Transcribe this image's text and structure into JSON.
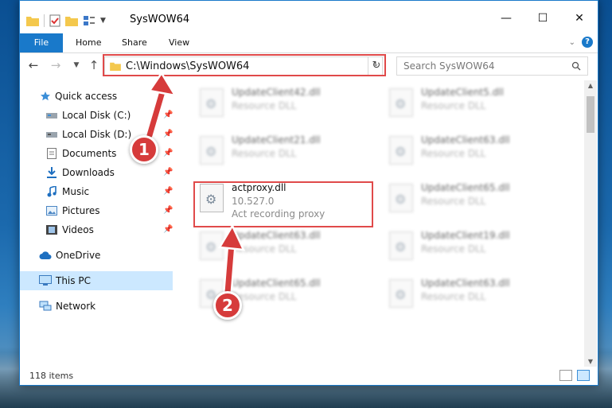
{
  "window": {
    "title": "SysWOW64",
    "controls": {
      "minimize": "—",
      "maximize": "☐",
      "close": "✕"
    }
  },
  "ribbon": {
    "tabs": {
      "file": "File",
      "home": "Home",
      "share": "Share",
      "view": "View"
    },
    "help": "?"
  },
  "navigation": {
    "address_path": "C:\\Windows\\SysWOW64",
    "search_placeholder": "Search SysWOW64"
  },
  "sidebar": {
    "items": [
      {
        "label": "Quick access",
        "icon": "star-icon",
        "pinned": false
      },
      {
        "label": "Local Disk (C:)",
        "icon": "drive-icon",
        "pinned": true
      },
      {
        "label": "Local Disk (D:)",
        "icon": "drive-icon",
        "pinned": true
      },
      {
        "label": "Documents",
        "icon": "document-icon",
        "pinned": true
      },
      {
        "label": "Downloads",
        "icon": "download-icon",
        "pinned": true
      },
      {
        "label": "Music",
        "icon": "music-icon",
        "pinned": true
      },
      {
        "label": "Pictures",
        "icon": "pictures-icon",
        "pinned": true
      },
      {
        "label": "Videos",
        "icon": "videos-icon",
        "pinned": true
      },
      {
        "label": "OneDrive",
        "icon": "cloud-icon",
        "pinned": false
      },
      {
        "label": "This PC",
        "icon": "computer-icon",
        "pinned": false,
        "selected": true
      },
      {
        "label": "Network",
        "icon": "network-icon",
        "pinned": false
      }
    ]
  },
  "files": {
    "col1": [
      {
        "name": "UpdateClient42.dll",
        "type": "Resource DLL"
      },
      {
        "name": "UpdateClient21.dll",
        "type": "Resource DLL"
      },
      {
        "name": "actproxy.dll",
        "version": "10.527.0",
        "description": "Act recording proxy"
      },
      {
        "name": "UpdateClient63.dll",
        "type": "Resource DLL"
      },
      {
        "name": "UpdateClient65.dll",
        "type": "Resource DLL"
      }
    ],
    "col2": [
      {
        "name": "UpdateClient5.dll",
        "type": "Resource DLL"
      },
      {
        "name": "UpdateClient63.dll",
        "type": "Resource DLL"
      },
      {
        "name": "UpdateClient65.dll",
        "type": "Resource DLL"
      },
      {
        "name": "UpdateClient19.dll",
        "type": "Resource DLL"
      },
      {
        "name": "UpdateClient63.dll",
        "type": "Resource DLL"
      }
    ]
  },
  "status": {
    "item_count": "118 items"
  },
  "annotations": {
    "step1": "1",
    "step2": "2",
    "color": "#d63b3b"
  }
}
